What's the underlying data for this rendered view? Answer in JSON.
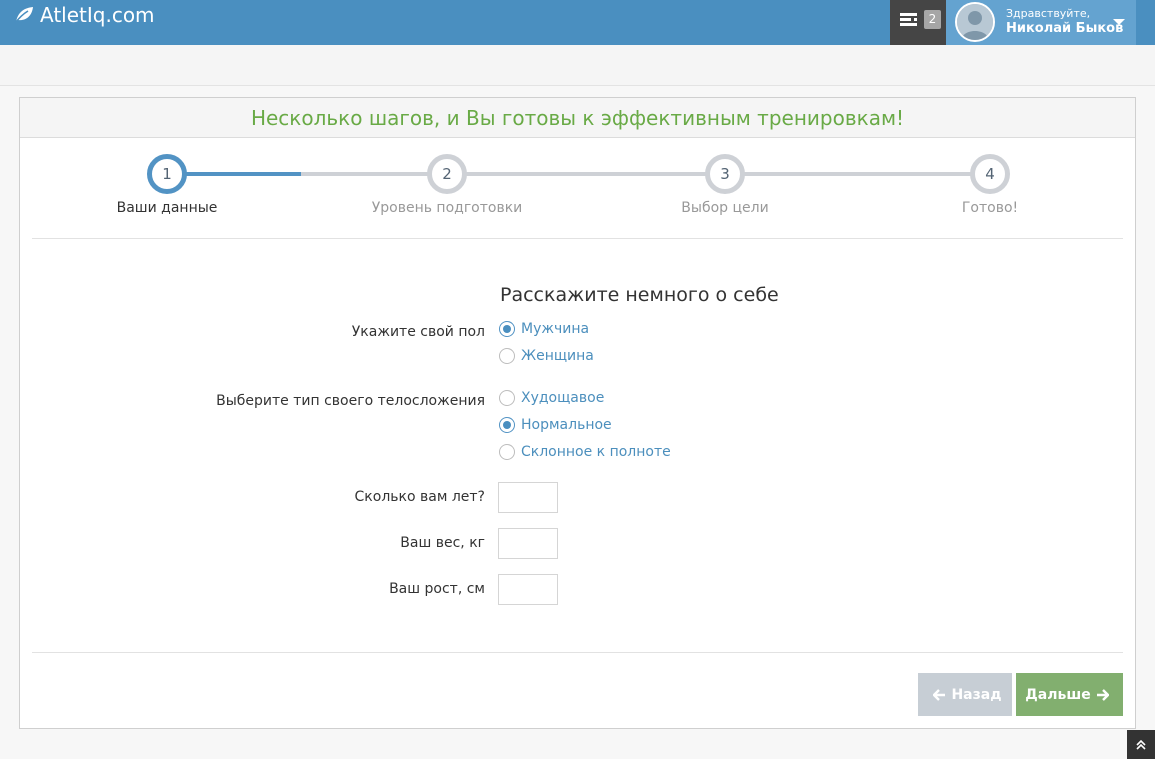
{
  "header": {
    "logo_text": "AtletIq.com",
    "tasks_badge": "2",
    "greeting": "Здравствуйте,",
    "user_name": "Николай Быков"
  },
  "wizard": {
    "title": "Несколько шагов, и Вы готовы к эффективным тренировкам!",
    "steps": [
      {
        "number": "1",
        "label": "Ваши данные",
        "active": true
      },
      {
        "number": "2",
        "label": "Уровень подготовки",
        "active": false
      },
      {
        "number": "3",
        "label": "Выбор цели",
        "active": false
      },
      {
        "number": "4",
        "label": "Готово!",
        "active": false
      }
    ],
    "progress_fraction": 0.165
  },
  "form": {
    "title": "Расскажите немного о себе",
    "gender": {
      "label": "Укажите свой пол",
      "options": [
        "Мужчина",
        "Женщина"
      ],
      "selected": "Мужчина"
    },
    "body_type": {
      "label": "Выберите тип своего телосложения",
      "options": [
        "Худощавое",
        "Нормальное",
        "Склонное к полноте"
      ],
      "selected": "Нормальное"
    },
    "age": {
      "label": "Сколько вам лет?",
      "value": ""
    },
    "weight": {
      "label": "Ваш вес, кг",
      "value": ""
    },
    "height": {
      "label": "Ваш рост, см",
      "value": ""
    }
  },
  "buttons": {
    "back_label": "Назад",
    "next_label": "Дальше"
  },
  "colors": {
    "topbar": "#4a8fc0",
    "accent_blue": "#5293c4",
    "title_green": "#69aa46",
    "next_button": "#82af6f",
    "back_button": "#c7ced5"
  },
  "icons": {
    "logo": "leaf-icon",
    "tasks": "tasks-icon",
    "back": "arrow-left-icon",
    "next": "arrow-right-icon",
    "scroll_top": "double-angle-up-icon"
  }
}
